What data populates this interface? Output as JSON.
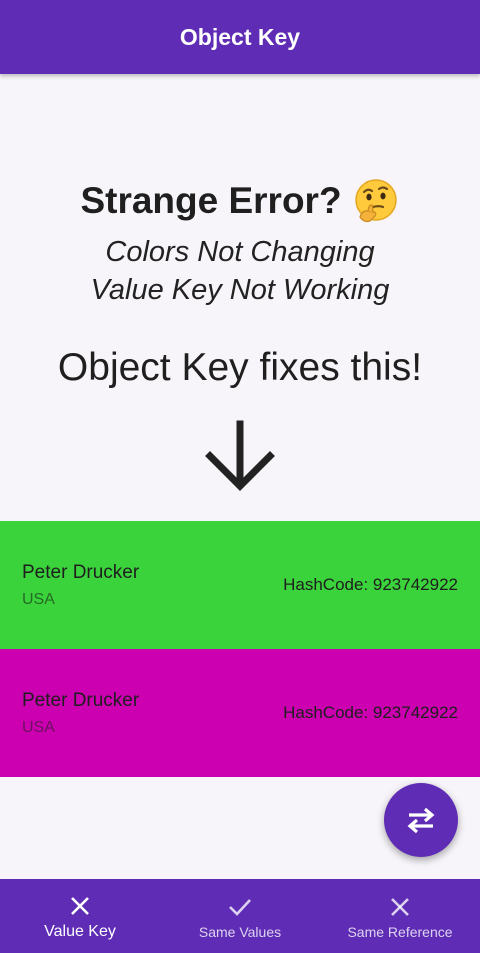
{
  "appbar": {
    "title": "Object Key"
  },
  "hero": {
    "headline": "Strange Error?",
    "headline_emoji": "thinking-face-icon",
    "subline_1": "Colors Not Changing",
    "subline_2": "Value Key Not Working",
    "fixes": "Object Key fixes this!",
    "arrow_icon": "arrow-down-icon"
  },
  "cards": [
    {
      "name": "Peter Drucker",
      "country": "USA",
      "hashcode": "HashCode: 923742922",
      "color": "#3bd33b"
    },
    {
      "name": "Peter Drucker",
      "country": "USA",
      "hashcode": "HashCode: 923742922",
      "color": "#cc00b0"
    }
  ],
  "fab": {
    "icon": "swap-horizontal-icon"
  },
  "bottom_nav": {
    "items": [
      {
        "label": "Value Key",
        "icon": "close-icon",
        "active": true
      },
      {
        "label": "Same Values",
        "icon": "check-icon",
        "active": false
      },
      {
        "label": "Same Reference",
        "icon": "close-icon",
        "active": false
      }
    ]
  },
  "colors": {
    "primary": "#5f2db5",
    "background": "#f7f5f9",
    "card_green": "#3bd33b",
    "card_magenta": "#cc00b0"
  }
}
